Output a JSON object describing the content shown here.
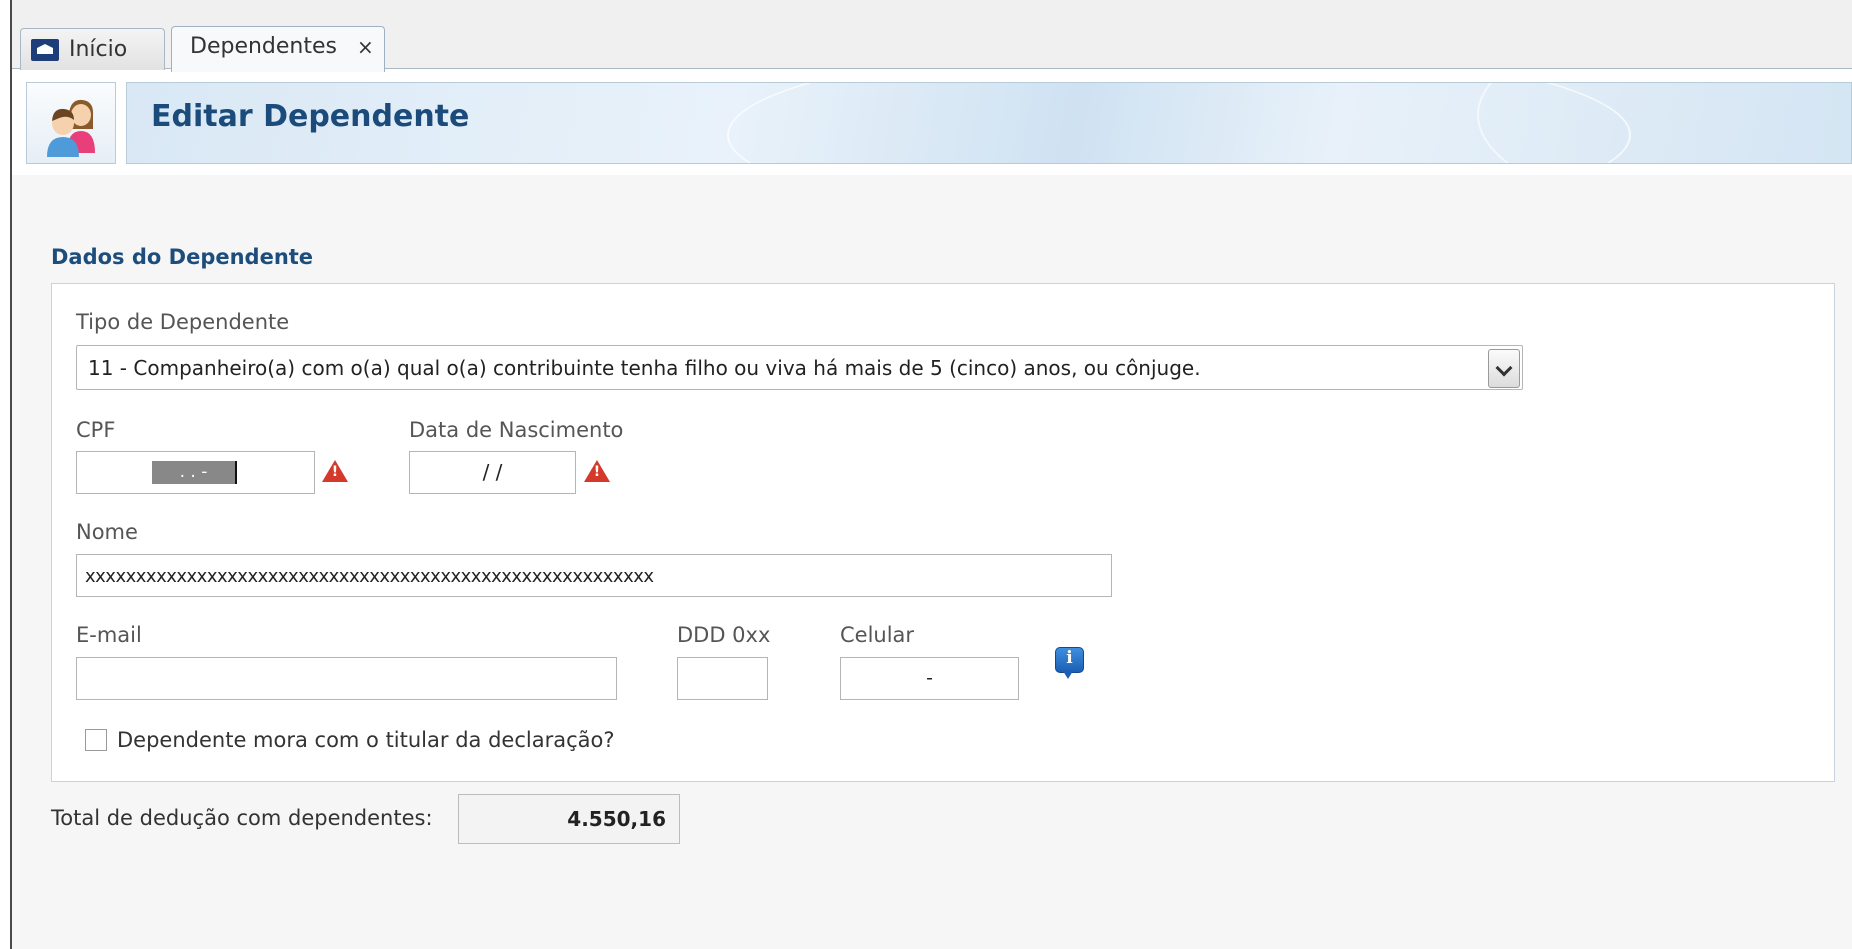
{
  "tabs": {
    "inicio_label": "Início",
    "dependentes_label": "Dependentes",
    "close_symbol": "×"
  },
  "header": {
    "title": "Editar Dependente"
  },
  "section": {
    "title": "Dados do Dependente"
  },
  "form": {
    "tipo_label": "Tipo de Dependente",
    "tipo_value": "11 - Companheiro(a) com o(a) qual o(a) contribuinte tenha filho ou viva há mais de 5 (cinco) anos, ou cônjuge.",
    "cpf_label": "CPF",
    "cpf_mask": " .  .  -",
    "nascimento_label": "Data de Nascimento",
    "nascimento_mask": "/ /",
    "nome_label": "Nome",
    "nome_value": "xxxxxxxxxxxxxxxxxxxxxxxxxxxxxxxxxxxxxxxxxxxxxxxxxxxxxxxx",
    "email_label": "E-mail",
    "email_value": "",
    "ddd_label": "DDD 0xx",
    "ddd_value": "",
    "celular_label": "Celular",
    "celular_mask": "-",
    "mora_label": "Dependente mora com o titular da declaração?",
    "mora_checked": false
  },
  "total": {
    "label": "Total de dedução com dependentes:",
    "value": "4.550,16"
  },
  "icons": {
    "warning": "warning-icon",
    "info": "info-icon",
    "home": "home-icon",
    "people": "people-icon"
  },
  "colors": {
    "title_blue": "#1b4b7a",
    "section_blue": "#1c4d7d",
    "warning_red": "#d33a2c",
    "info_blue": "#1b5fb3"
  }
}
